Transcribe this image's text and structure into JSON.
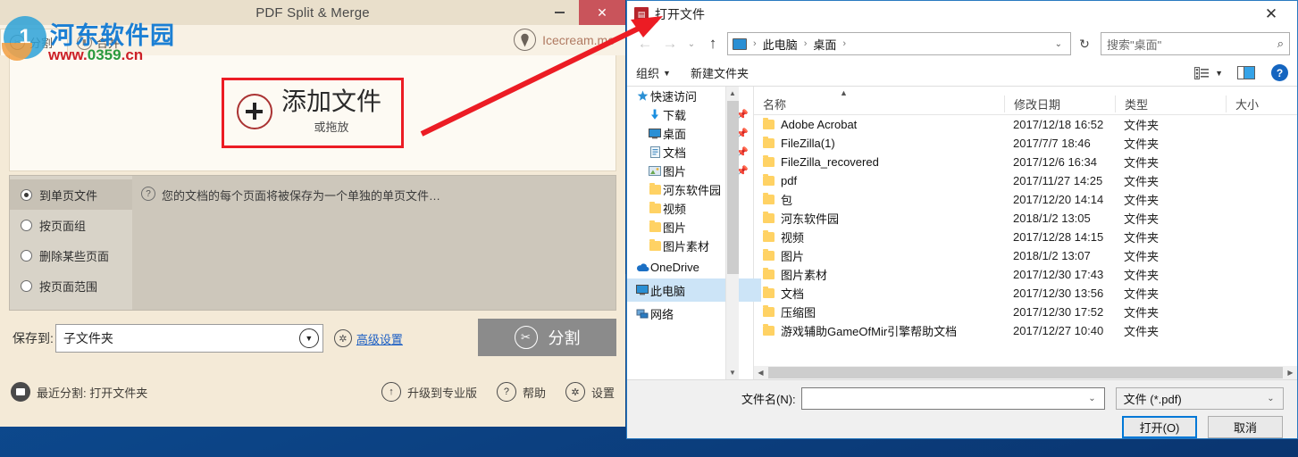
{
  "app": {
    "title": "PDF Split & Merge",
    "minimize_label": "—",
    "close_label": "✕",
    "tabs": [
      {
        "label": "分割",
        "icon": "scissors-icon",
        "active": true
      },
      {
        "label": "合并",
        "icon": "merge-icon",
        "active": false
      }
    ],
    "brand": {
      "label": "Icecream.me",
      "icon": "icecream-cone-icon"
    },
    "dropzone": {
      "title": "添加文件",
      "subtitle": "或拖放",
      "icon": "plus-circle-icon"
    },
    "modes": [
      {
        "label": "到单页文件",
        "selected": true
      },
      {
        "label": "按页面组",
        "selected": false
      },
      {
        "label": "删除某些页面",
        "selected": false
      },
      {
        "label": "按页面范围",
        "selected": false
      }
    ],
    "mode_description": "您的文档的每个页面将被保存为一个单独的单页文件…",
    "save": {
      "label": "保存到:",
      "value": "子文件夹",
      "caret": "▼",
      "gear_icon": "gear-icon",
      "advanced_link": "高级设置"
    },
    "split_button": {
      "label": "分割",
      "icon": "scissors-icon"
    },
    "footer": [
      {
        "label": "最近分割: 打开文件夹",
        "icon": "folder-icon"
      },
      {
        "label": "升级到专业版",
        "icon": "up-arrow-icon"
      },
      {
        "label": "帮助",
        "icon": "question-icon"
      },
      {
        "label": "设置",
        "icon": "gear-icon"
      }
    ]
  },
  "watermark": {
    "title": "河东软件园",
    "url_red_1": "www.",
    "url_green": "0359",
    "url_red_2": ".cn",
    "logo_text": "1"
  },
  "dialog": {
    "title": "打开文件",
    "close_label": "✕",
    "nav": {
      "back": "←",
      "forward": "→",
      "history": "⌄",
      "up": "↑",
      "breadcrumbs": [
        "此电脑",
        "桌面"
      ],
      "breadcrumb_sep": "›",
      "address_caret": "⌄",
      "refresh": "↻"
    },
    "search": {
      "placeholder": "搜索\"桌面\"",
      "icon": "search-icon"
    },
    "toolbar": {
      "organize": "组织",
      "organize_caret": "▼",
      "new_folder": "新建文件夹",
      "view_icon": "view-layout-icon",
      "view_caret": "▼",
      "preview_icon": "preview-pane-icon",
      "help_icon": "help-icon",
      "help_label": "?"
    },
    "tree": [
      {
        "label": "快速访问",
        "icon": "quick-access-icon",
        "indent": false,
        "pinned": false,
        "selected": false
      },
      {
        "label": "下载",
        "icon": "downloads-icon",
        "indent": true,
        "pinned": true,
        "selected": false
      },
      {
        "label": "桌面",
        "icon": "desktop-icon",
        "indent": true,
        "pinned": true,
        "selected": false
      },
      {
        "label": "文档",
        "icon": "documents-icon",
        "indent": true,
        "pinned": true,
        "selected": false
      },
      {
        "label": "图片",
        "icon": "pictures-icon",
        "indent": true,
        "pinned": true,
        "selected": false
      },
      {
        "label": "河东软件园",
        "icon": "folder-icon",
        "indent": true,
        "pinned": false,
        "selected": false
      },
      {
        "label": "视频",
        "icon": "folder-icon",
        "indent": true,
        "pinned": false,
        "selected": false
      },
      {
        "label": "图片",
        "icon": "folder-icon",
        "indent": true,
        "pinned": false,
        "selected": false
      },
      {
        "label": "图片素材",
        "icon": "folder-icon",
        "indent": true,
        "pinned": false,
        "selected": false
      },
      {
        "label": "OneDrive",
        "icon": "onedrive-icon",
        "indent": false,
        "pinned": false,
        "selected": false
      },
      {
        "label": "此电脑",
        "icon": "this-pc-icon",
        "indent": false,
        "pinned": false,
        "selected": true
      },
      {
        "label": "网络",
        "icon": "network-icon",
        "indent": false,
        "pinned": false,
        "selected": false
      }
    ],
    "columns": [
      "名称",
      "修改日期",
      "类型",
      "大小"
    ],
    "sort_caret": "▲",
    "files": [
      {
        "name": "Adobe Acrobat",
        "date": "2017/12/18 16:52",
        "type": "文件夹",
        "size": ""
      },
      {
        "name": "FileZilla(1)",
        "date": "2017/7/7 18:46",
        "type": "文件夹",
        "size": ""
      },
      {
        "name": "FileZilla_recovered",
        "date": "2017/12/6 16:34",
        "type": "文件夹",
        "size": ""
      },
      {
        "name": "pdf",
        "date": "2017/11/27 14:25",
        "type": "文件夹",
        "size": ""
      },
      {
        "name": "包",
        "date": "2017/12/20 14:14",
        "type": "文件夹",
        "size": ""
      },
      {
        "name": "河东软件园",
        "date": "2018/1/2 13:05",
        "type": "文件夹",
        "size": ""
      },
      {
        "name": "视频",
        "date": "2017/12/28 14:15",
        "type": "文件夹",
        "size": ""
      },
      {
        "name": "图片",
        "date": "2018/1/2 13:07",
        "type": "文件夹",
        "size": ""
      },
      {
        "name": "图片素材",
        "date": "2017/12/30 17:43",
        "type": "文件夹",
        "size": ""
      },
      {
        "name": "文档",
        "date": "2017/12/30 13:56",
        "type": "文件夹",
        "size": ""
      },
      {
        "name": "压缩图",
        "date": "2017/12/30 17:52",
        "type": "文件夹",
        "size": ""
      },
      {
        "name": "游戏辅助GameOfMir引擎帮助文档",
        "date": "2017/12/27 10:40",
        "type": "文件夹",
        "size": ""
      }
    ],
    "filename": {
      "label": "文件名(N):",
      "value": "",
      "caret": "⌄"
    },
    "filter": {
      "value": "文件 (*.pdf)",
      "caret": "⌄"
    },
    "open_button": "打开(O)",
    "cancel_button": "取消"
  },
  "colors": {
    "accent_blue": "#0078d7",
    "app_bg": "#f4ead7",
    "close_red": "#c9545b",
    "annotation_red": "#ec1c24",
    "link_blue": "#1c5fc4"
  }
}
